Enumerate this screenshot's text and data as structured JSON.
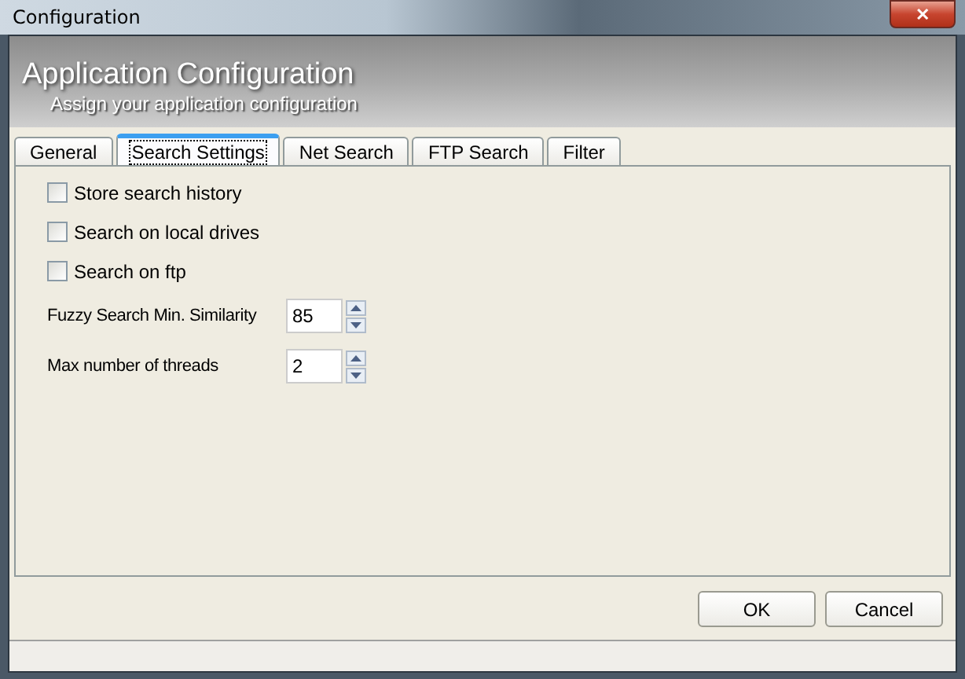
{
  "window": {
    "title": "Configuration",
    "close": "✕"
  },
  "header": {
    "title": "Application Configuration",
    "subtitle": "Assign your application configuration"
  },
  "tabs": [
    {
      "label": "General",
      "selected": false
    },
    {
      "label": "Search Settings",
      "selected": true
    },
    {
      "label": "Net Search",
      "selected": false
    },
    {
      "label": "FTP Search",
      "selected": false
    },
    {
      "label": "Filter",
      "selected": false
    }
  ],
  "options": [
    {
      "kind": "checkbox",
      "label": "Store search history",
      "checked": false
    },
    {
      "kind": "checkbox",
      "label": "Search on local drives",
      "checked": false
    },
    {
      "kind": "checkbox",
      "label": "Search on ftp",
      "checked": false
    },
    {
      "kind": "spin",
      "label": "Fuzzy Search Min. Similarity",
      "value": "85"
    },
    {
      "kind": "spin",
      "label": "Max number of threads",
      "value": "2"
    }
  ],
  "buttons": [
    "OK",
    "Cancel"
  ]
}
